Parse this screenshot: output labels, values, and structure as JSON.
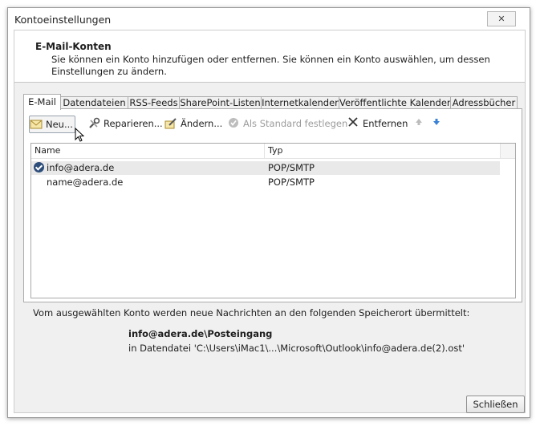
{
  "window": {
    "title": "Kontoeinstellungen",
    "close_icon": "✕"
  },
  "header": {
    "title": "E-Mail-Konten",
    "description": "Sie können ein Konto hinzufügen oder entfernen. Sie können ein Konto auswählen, um dessen Einstellungen zu ändern."
  },
  "tabs": [
    {
      "label": "E-Mail"
    },
    {
      "label": "Datendateien"
    },
    {
      "label": "RSS-Feeds"
    },
    {
      "label": "SharePoint-Listen"
    },
    {
      "label": "Internetkalender"
    },
    {
      "label": "Veröffentlichte Kalender"
    },
    {
      "label": "Adressbücher"
    }
  ],
  "toolbar": {
    "new_label": "Neu...",
    "repair_label": "Reparieren...",
    "change_label": "Ändern...",
    "set_default_label": "Als Standard festlegen",
    "remove_label": "Entfernen"
  },
  "accounts": {
    "columns": [
      "Name",
      "Typ"
    ],
    "rows": [
      {
        "name": "info@adera.de",
        "type": "POP/SMTP",
        "default": true
      },
      {
        "name": "name@adera.de",
        "type": "POP/SMTP",
        "default": false
      }
    ]
  },
  "delivery": {
    "info": "Vom ausgewählten Konto werden neue Nachrichten an den folgenden Speicherort übermittelt:",
    "location": "info@adera.de\\Posteingang",
    "file": "in Datendatei 'C:\\Users\\iMac1\\...\\Microsoft\\Outlook\\info@adera.de(2).ost'"
  },
  "footer": {
    "close_label": "Schließen"
  },
  "colors": {
    "accent": "#2d4d7a",
    "arrow_blue": "#3b82d6",
    "remove_x": "#333333"
  }
}
